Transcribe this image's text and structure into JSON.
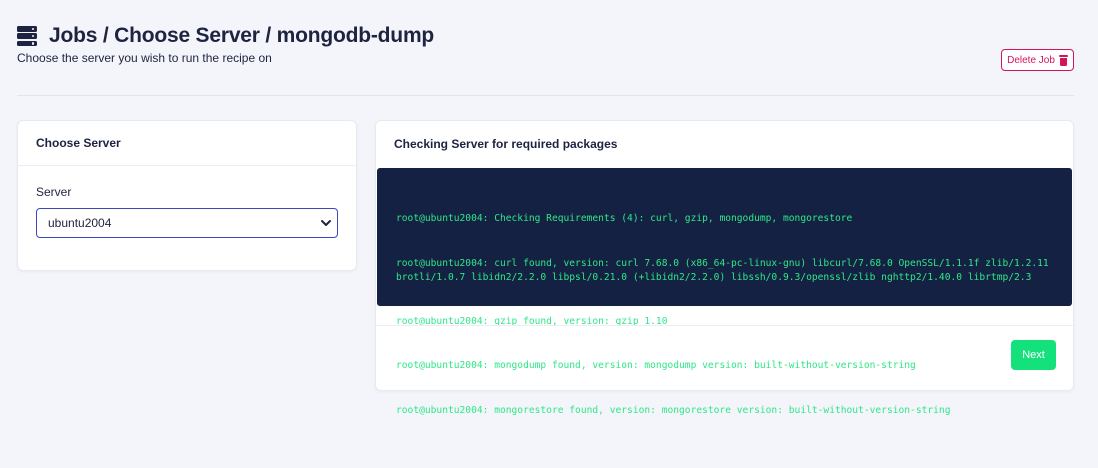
{
  "header": {
    "title": "Jobs / Choose Server / mongodb-dump",
    "subtitle": "Choose the server you wish to run the recipe on",
    "icon": "server-icon",
    "delete_label": "Delete Job",
    "delete_icon": "trash-icon",
    "delete_color": "#d4145a"
  },
  "choose_server": {
    "title": "Choose Server",
    "field_label": "Server",
    "selected_value": "ubuntu2004"
  },
  "checking": {
    "title": "Checking Server for required packages",
    "terminal_lines": [
      "root@ubuntu2004: Checking Requirements (4): curl, gzip, mongodump, mongorestore",
      "root@ubuntu2004: curl found, version: curl 7.68.0 (x86_64-pc-linux-gnu) libcurl/7.68.0 OpenSSL/1.1.1f zlib/1.2.11 brotli/1.0.7 libidn2/2.2.0 libpsl/0.21.0 (+libidn2/2.2.0) libssh/0.9.3/openssl/zlib nghttp2/1.40.0 librtmp/2.3",
      "root@ubuntu2004: gzip found, version: gzip 1.10",
      "root@ubuntu2004: mongodump found, version: mongodump version: built-without-version-string",
      "root@ubuntu2004: mongorestore found, version: mongorestore version: built-without-version-string"
    ],
    "next_label": "Next",
    "terminal_bg": "#142143",
    "terminal_text_color": "#2ee887",
    "next_color": "#15e17c"
  }
}
